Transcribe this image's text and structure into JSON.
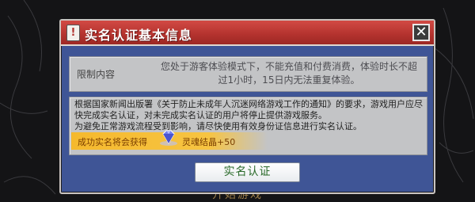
{
  "dialog": {
    "title": "实名认证基本信息",
    "close_glyph": "✕",
    "restriction": {
      "label": "限制内容",
      "message": "您处于游客体验模式下，不能充值和付费消费，体验时长不超过1小时，15日内无法重复体验。"
    },
    "notice": "根据国家新闻出版署《关于防止未成年人沉迷网络游戏工作的通知》的要求，游戏用户应尽快完成实名认证，对未完成实名认证的用户将停止提供游戏服务。\n为避免正常游戏流程受到影响，请尽快使用有效身份证信息进行实名认证。",
    "reward": {
      "prefix": "成功实名将会获得",
      "item": "灵魂结晶+50",
      "icon": "diamond-gem-icon"
    },
    "verify_button": "实名认证"
  },
  "background": {
    "start_game_label": "开始游戏"
  },
  "colors": {
    "title_bar": "#b3322e",
    "dialog_body": "#3f5596",
    "panel": "#c3c4c6",
    "reward_strip": "#f5b92e",
    "button_text": "#2a6a2a"
  }
}
